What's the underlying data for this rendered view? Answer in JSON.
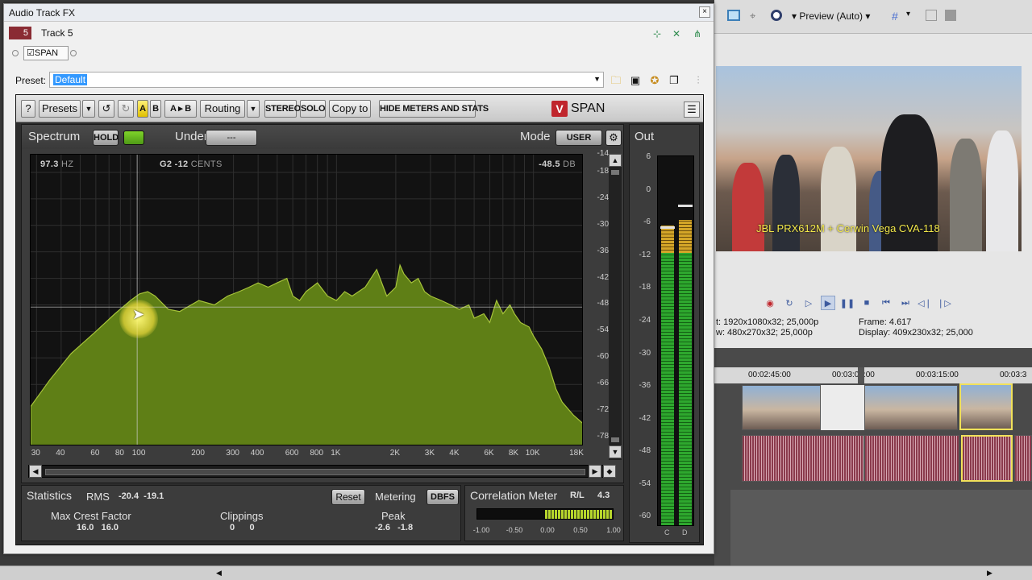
{
  "window": {
    "title": "Audio Track FX",
    "close_label": "×"
  },
  "track": {
    "number": "5",
    "name": "Track 5"
  },
  "chain": {
    "plugin_label": "SPAN",
    "checked": true
  },
  "preset": {
    "label": "Preset:",
    "value": "Default"
  },
  "toolbar": {
    "help": "?",
    "presets": "Presets",
    "a": "A",
    "b": "B",
    "ab": "A ▸ B",
    "routing": "Routing",
    "stereo": "STEREO",
    "solo": "SOLO",
    "copy_to": "Copy to",
    "hide_meters": "HIDE METERS AND STATS",
    "logo_text": "SPAN"
  },
  "spectrum": {
    "title": "Spectrum",
    "hold": "HOLD",
    "underlay": "Underlay",
    "underlay_value": "---",
    "mode_label": "Mode",
    "mode_value": "USER",
    "readout_freq": "97.3",
    "readout_freq_unit": "HZ",
    "readout_note": "G2 -12",
    "readout_note_unit": "CENTS",
    "readout_db": "-48.5",
    "readout_db_unit": "DB",
    "y_ticks": [
      "-14",
      "-18",
      "-24",
      "-30",
      "-36",
      "-42",
      "-48",
      "-54",
      "-60",
      "-66",
      "-72",
      "-78"
    ],
    "x_ticks": [
      "30",
      "40",
      "60",
      "80",
      "100",
      "200",
      "300",
      "400",
      "600",
      "800",
      "1K",
      "2K",
      "3K",
      "4K",
      "6K",
      "8K",
      "10K",
      "18K"
    ],
    "colors": {
      "fill": "#5f7f16",
      "edge": "#a7c43a",
      "bg": "#121212"
    }
  },
  "chart_data": {
    "type": "area",
    "xscale": "log",
    "xlabel": "",
    "ylabel": "",
    "xlim": [
      28,
      18000
    ],
    "ylim": [
      -80,
      -14
    ],
    "series": [
      {
        "x": [
          28,
          35,
          45,
          60,
          75,
          90,
          100,
          110,
          120,
          140,
          160,
          200,
          240,
          280,
          320,
          360,
          400,
          450,
          500,
          560,
          600,
          650,
          700,
          800,
          900,
          1000,
          1100,
          1200,
          1400,
          1600,
          1800,
          2000,
          2100,
          2200,
          2400,
          2600,
          2800,
          3000,
          3400,
          3800,
          4200,
          4700,
          5000,
          5600,
          6000,
          6500,
          7000,
          7600,
          8000,
          8600,
          9500,
          10000,
          11000,
          12000,
          13000,
          14000,
          16000,
          18000
        ],
        "y": [
          -71,
          -65,
          -59,
          -54,
          -50,
          -47,
          -45.5,
          -45,
          -46,
          -49,
          -49.5,
          -47,
          -48,
          -46,
          -45,
          -44,
          -43,
          -44,
          -43,
          -42,
          -46,
          -47,
          -45,
          -43,
          -46,
          -47,
          -45,
          -46,
          -44,
          -40,
          -46,
          -44,
          -39,
          -41,
          -43,
          -42,
          -45,
          -46,
          -47,
          -48,
          -49,
          -48,
          -51,
          -50,
          -52,
          -47,
          -50,
          -48,
          -50,
          -52,
          -53,
          -55,
          -58,
          -62,
          -67,
          -70,
          -73,
          -75
        ]
      }
    ]
  },
  "out": {
    "title": "Out",
    "ticks": [
      "6",
      "0",
      "-6",
      "-12",
      "-18",
      "-24",
      "-30",
      "-36",
      "-42",
      "-48",
      "-54",
      "-60"
    ],
    "left_label": "C",
    "right_label": "D",
    "left_level_db": -7,
    "right_level_db": -6,
    "left_peak_db": -7,
    "right_peak_db": -3
  },
  "stats": {
    "title": "Statistics",
    "rms_label": "RMS",
    "rms_values": "-20.4  -19.1",
    "reset": "Reset",
    "metering_label": "Metering",
    "metering_value": "DBFS",
    "crest_label": "Max Crest Factor",
    "crest_values": "16.0   16.0",
    "clip_label": "Clippings",
    "clip_values": "0      0",
    "peak_label": "Peak",
    "peak_values": "-2.6   -1.8"
  },
  "correlation": {
    "title": "Correlation Meter",
    "rl_label": "R/L",
    "rl_value": "4.3",
    "ticks": [
      "-1.00",
      "-0.50",
      "0.00",
      "0.50",
      "1.00"
    ]
  },
  "host": {
    "preview_label": "Preview (Auto)",
    "video_caption": "JBL PRX612M + Cerwin Vega CVA-118",
    "info_left": [
      "t:   1920x1080x32; 25,000p",
      "w:  480x270x32; 25,000p"
    ],
    "info_right": [
      "Frame:     4.617",
      "Display:  409x230x32; 25,000"
    ],
    "ruler": [
      "00:02:45:00",
      "00:03:00:00",
      "00:03:15:00",
      "00:03:3"
    ]
  }
}
